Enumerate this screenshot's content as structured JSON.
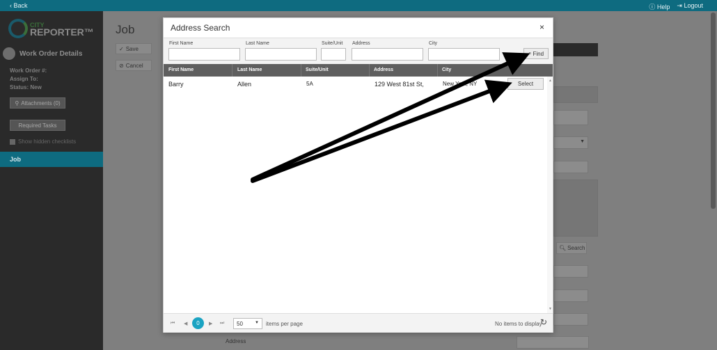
{
  "topbar": {
    "back": "‹ Back",
    "help": "Help",
    "logout": "Logout"
  },
  "logo": {
    "line1": "CITY",
    "line2": "REPORTER™"
  },
  "sidebar": {
    "title": "Work Order Details",
    "fields": [
      "Work Order #:",
      "Assign To:",
      "Status: New"
    ],
    "attachments": "Attachments (0)",
    "required_tasks": "Required Tasks",
    "show_hidden": "Show hidden checklists",
    "job": "Job"
  },
  "main": {
    "title": "Job",
    "save": "Save",
    "cancel": "Cancel",
    "search": "Search",
    "address": "Address"
  },
  "modal": {
    "title": "Address Search",
    "close": "×",
    "filters": {
      "first_name": "First Name",
      "last_name": "Last Name",
      "suite_unit": "Suite/Unit",
      "address": "Address",
      "city": "City"
    },
    "find": "Find",
    "columns": [
      "First Name",
      "Last Name",
      "Suite/Unit",
      "Address",
      "City"
    ],
    "rows": [
      {
        "first_name": "Barry",
        "last_name": "Allen",
        "suite": "5A",
        "address": "129 West 81st St,",
        "city": "New York, NY",
        "action": "Select"
      }
    ],
    "pager": {
      "current_page": "0",
      "page_size": "50",
      "items_per_page": "items per page",
      "status": "No items to display"
    }
  },
  "colors": {
    "topbar": "#0e6b80",
    "accent": "#1aa3c2",
    "overlay": "#7f7f7f"
  }
}
